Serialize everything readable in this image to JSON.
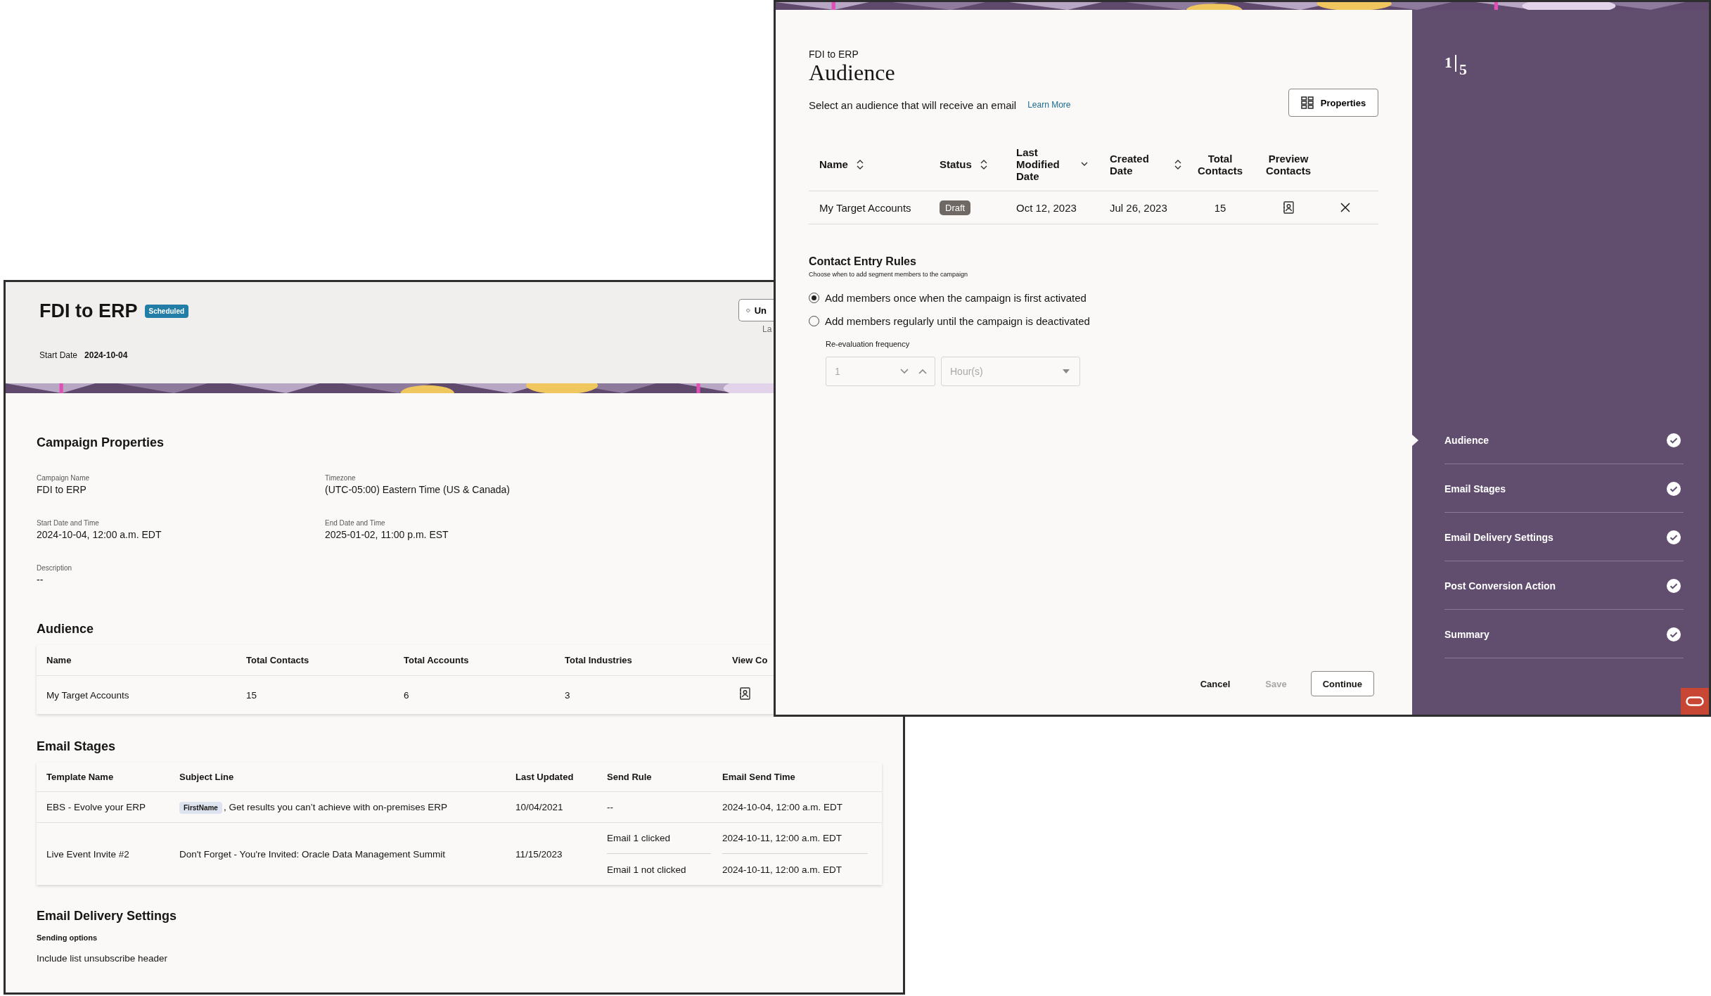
{
  "back_window": {
    "title": "FDI to ERP",
    "status_badge": "Scheduled",
    "header_button": "Un",
    "header_note": "La",
    "start_date": {
      "label": "Start Date",
      "value": "2024-10-04"
    },
    "campaign_properties": {
      "heading": "Campaign Properties",
      "fields": [
        {
          "label": "Campaign Name",
          "value": "FDI to ERP"
        },
        {
          "label": "Timezone",
          "value": "(UTC-05:00) Eastern Time (US & Canada)"
        },
        {
          "label": "Start Date and Time",
          "value": "2024-10-04, 12:00 a.m. EDT"
        },
        {
          "label": "End Date and Time",
          "value": "2025-01-02, 11:00 p.m. EST"
        },
        {
          "label": "Description",
          "value": "--"
        }
      ]
    },
    "audience": {
      "heading": "Audience",
      "columns": [
        "Name",
        "Total Contacts",
        "Total Accounts",
        "Total Industries",
        "View Co"
      ],
      "rows": [
        {
          "name": "My Target Accounts",
          "total_contacts": "15",
          "total_accounts": "6",
          "total_industries": "3"
        }
      ]
    },
    "email_stages": {
      "heading": "Email Stages",
      "columns": [
        "Template Name",
        "Subject Line",
        "Last Updated",
        "Send Rule",
        "Email Send Time"
      ],
      "rows": [
        {
          "template": "EBS - Evolve your ERP",
          "subject_token": "FirstName",
          "subject": ", Get results you can’t achieve with on-premises ERP",
          "last_updated": "10/04/2021",
          "rules": [
            {
              "send_rule": "--",
              "send_time": "2024-10-04, 12:00 a.m. EDT"
            }
          ]
        },
        {
          "template": "Live Event Invite #2",
          "subject": "Don't Forget - You're Invited: Oracle Data Management Summit",
          "last_updated": "11/15/2023",
          "rules": [
            {
              "send_rule": "Email 1 clicked",
              "send_time": "2024-10-11, 12:00 a.m. EDT"
            },
            {
              "send_rule": "Email 1 not clicked",
              "send_time": "2024-10-11, 12:00 a.m. EDT"
            }
          ]
        }
      ]
    },
    "delivery": {
      "heading": "Email Delivery Settings",
      "label": "Sending options",
      "value": "Include list unsubscribe header"
    }
  },
  "front_window": {
    "breadcrumb": "FDI to ERP",
    "title": "Audience",
    "subtitle": "Select an audience that will receive an email",
    "learn_more": "Learn More",
    "properties_button": "Properties",
    "table": {
      "columns": [
        {
          "label": "Name",
          "kind": "sortable"
        },
        {
          "label": "Status",
          "kind": "sortable"
        },
        {
          "label": "Last Modified Date",
          "kind": "sorted"
        },
        {
          "label": "Created Date",
          "kind": "sortable"
        },
        {
          "label": "Total Contacts",
          "kind": "plain"
        },
        {
          "label": "Preview Contacts",
          "kind": "plain"
        }
      ],
      "rows": [
        {
          "name": "My Target Accounts",
          "status": "Draft",
          "last_modified": "Oct 12, 2023",
          "created": "Jul 26, 2023",
          "total_contacts": "15"
        }
      ]
    },
    "rules": {
      "heading": "Contact Entry Rules",
      "hint": "Choose when to add segment members to the campaign",
      "options": [
        {
          "label": "Add members once when the campaign is first activated",
          "selected": true
        },
        {
          "label": "Add members regularly until the campaign is deactivated",
          "selected": false
        }
      ],
      "frequency": {
        "label": "Re-evaluation frequency",
        "value": "1",
        "unit": "Hour(s)",
        "disabled": true
      }
    },
    "buttons": [
      {
        "label": "Cancel",
        "kind": "text",
        "disabled": false
      },
      {
        "label": "Save",
        "kind": "text",
        "disabled": true
      },
      {
        "label": "Continue",
        "kind": "outline",
        "disabled": false
      }
    ]
  },
  "wizard": {
    "current": "1",
    "total": "5",
    "steps": [
      {
        "label": "Audience",
        "selected": true,
        "completed": true
      },
      {
        "label": "Email Stages",
        "selected": false,
        "completed": true
      },
      {
        "label": "Email Delivery Settings",
        "selected": false,
        "completed": true
      },
      {
        "label": "Post Conversion Action",
        "selected": false,
        "completed": true
      },
      {
        "label": "Summary",
        "selected": false,
        "completed": true
      }
    ]
  }
}
